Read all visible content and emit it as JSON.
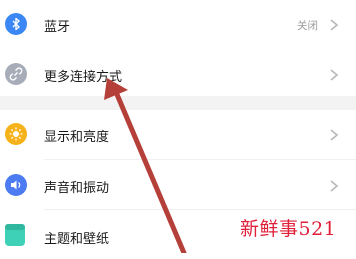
{
  "settings": {
    "items": [
      {
        "label": "蓝牙",
        "value": "关闭",
        "icon": "bluetooth-icon",
        "color": "#3b87f5"
      },
      {
        "label": "更多连接方式",
        "icon": "link-icon",
        "color": "#a7adb8"
      },
      {
        "label": "显示和亮度",
        "icon": "brightness-icon",
        "color": "#f6b21b"
      },
      {
        "label": "声音和振动",
        "icon": "volume-icon",
        "color": "#4d7cf2"
      },
      {
        "label": "主题和壁纸",
        "icon": "theme-icon",
        "color": "#3fd1b8"
      }
    ]
  },
  "annotation": {
    "arrow_color": "#b5403a",
    "watermark": "新鲜事521",
    "watermark_color": "#e0203a"
  }
}
